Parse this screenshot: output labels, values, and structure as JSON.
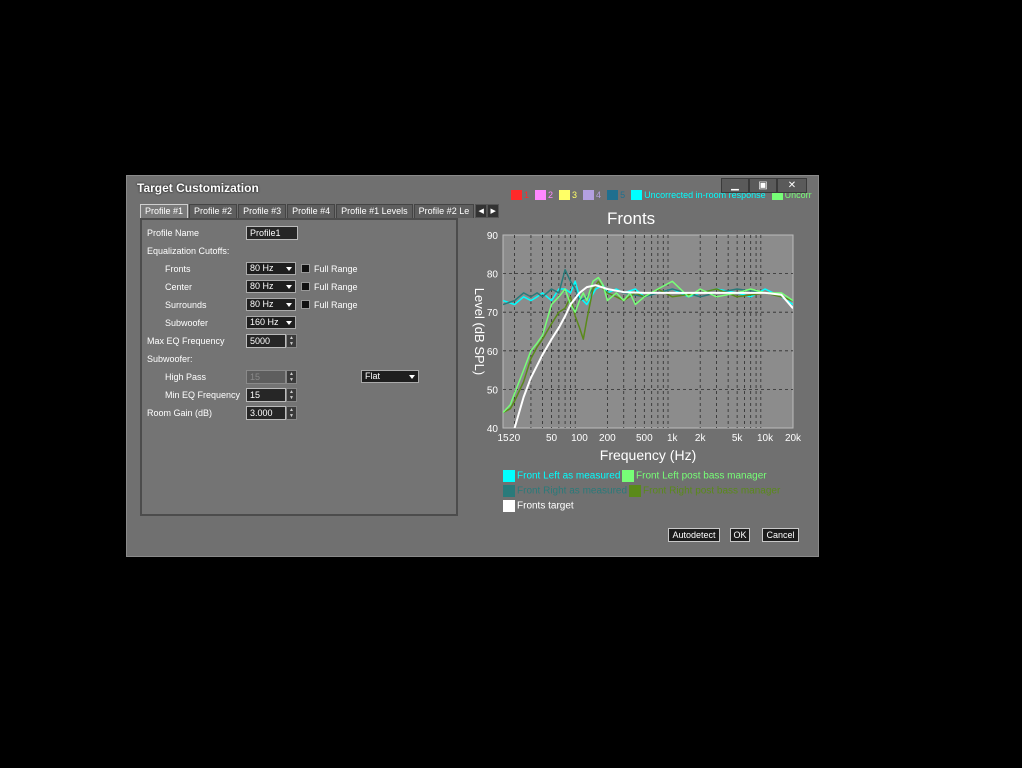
{
  "window": {
    "title": "Target Customization",
    "minimize_glyph": "▁",
    "maximize_glyph": "▣",
    "close_glyph": "✕"
  },
  "channel_swatches": [
    {
      "label": "1",
      "color": "#ff2a2a"
    },
    {
      "label": "2",
      "color": "#ff88ff"
    },
    {
      "label": "3",
      "color": "#ffff66"
    },
    {
      "label": "4",
      "color": "#b3a0e0"
    },
    {
      "label": "5",
      "color": "#1f6f8f"
    },
    {
      "label": "Uncorrected in-room response",
      "color": "#00ffff"
    },
    {
      "label": "Uncorr",
      "color": "#77ff77"
    }
  ],
  "tabs": [
    "Profile #1",
    "Profile #2",
    "Profile #3",
    "Profile #4",
    "Profile #1 Levels",
    "Profile #2 Le"
  ],
  "tab_arrows": {
    "left": "◀",
    "right": "▶"
  },
  "form": {
    "profile_name_label": "Profile Name",
    "profile_name_value": "Profile1",
    "eq_cutoffs_label": "Equalization Cutoffs:",
    "fronts_label": "Fronts",
    "fronts_value": "80 Hz",
    "center_label": "Center",
    "center_value": "80 Hz",
    "surrounds_label": "Surrounds",
    "surrounds_value": "80 Hz",
    "subwoofer_label": "Subwoofer",
    "subwoofer_value": "160 Hz",
    "full_range_label": "Full Range",
    "max_eq_label": "Max EQ Frequency",
    "max_eq_value": "5000",
    "subwoofer_section_label": "Subwoofer:",
    "high_pass_label": "High Pass",
    "high_pass_value": "15",
    "high_pass_mode": "Flat",
    "min_eq_label": "Min EQ Frequency",
    "min_eq_value": "15",
    "room_gain_label": "Room Gain (dB)",
    "room_gain_value": "3.000"
  },
  "buttons": {
    "autodetect": "Autodetect",
    "ok": "OK",
    "cancel": "Cancel"
  },
  "legend": [
    {
      "label": "Front Left as measured",
      "color": "#00ffff"
    },
    {
      "label": "Front Left post bass manager",
      "color": "#77ff77"
    },
    {
      "label": "Front Right as measured",
      "color": "#2a7a7a"
    },
    {
      "label": "Front Right post bass manager",
      "color": "#5a8a1a"
    },
    {
      "label": "Fronts target",
      "color": "#ffffff"
    }
  ],
  "chart_data": {
    "type": "line",
    "title": "Fronts",
    "xlabel": "Frequency (Hz)",
    "ylabel": "Level (dB SPL)",
    "x_scale": "log",
    "xlim": [
      15,
      20000
    ],
    "ylim": [
      40,
      90
    ],
    "x_ticks": [
      15,
      20,
      50,
      100,
      200,
      500,
      1000,
      2000,
      5000,
      10000,
      20000
    ],
    "x_tick_labels": [
      "15",
      "20",
      "50",
      "100",
      "200",
      "500",
      "1k",
      "2k",
      "5k",
      "10k",
      "20k"
    ],
    "y_ticks": [
      40,
      50,
      60,
      70,
      80,
      90
    ],
    "y_tick_labels": [
      "40",
      "50",
      "60",
      "70",
      "80",
      "90"
    ],
    "grid": true,
    "background": "#8c8c8c",
    "series": [
      {
        "name": "Front Left as measured",
        "color": "#00ffff",
        "width": 1.5,
        "x": [
          15,
          20,
          25,
          30,
          35,
          40,
          50,
          60,
          70,
          80,
          90,
          100,
          120,
          150,
          180,
          200,
          250,
          300,
          400,
          500,
          700,
          1000,
          1500,
          2000,
          3000,
          5000,
          7000,
          10000,
          15000,
          20000
        ],
        "y": [
          73,
          72,
          74,
          73,
          74,
          75,
          73,
          76,
          76,
          75,
          78,
          74,
          72,
          76,
          77,
          75,
          76,
          75,
          76,
          74,
          75,
          76,
          74,
          75,
          76,
          75,
          74,
          76,
          74,
          72
        ]
      },
      {
        "name": "Front Right as measured",
        "color": "#2a7a7a",
        "width": 1.5,
        "x": [
          15,
          20,
          25,
          30,
          35,
          40,
          50,
          60,
          70,
          80,
          90,
          100,
          120,
          150,
          200,
          300,
          500,
          700,
          1000,
          2000,
          3000,
          5000,
          10000,
          15000,
          20000
        ],
        "y": [
          72,
          73,
          75,
          74,
          75,
          74,
          76,
          75,
          81,
          78,
          76,
          73,
          74,
          77,
          76,
          75,
          74,
          75,
          76,
          74,
          75,
          76,
          75,
          74,
          73
        ]
      },
      {
        "name": "Front Right post bass manager",
        "color": "#5a8a1a",
        "width": 1.5,
        "x": [
          15,
          18,
          20,
          25,
          30,
          35,
          40,
          50,
          60,
          70,
          80,
          90,
          100,
          110,
          120,
          140,
          160,
          180,
          200,
          250,
          300,
          400,
          500,
          700,
          1000,
          2000,
          3000,
          5000,
          10000,
          15000,
          20000
        ],
        "y": [
          44,
          45,
          47,
          52,
          58,
          61,
          63,
          67,
          70,
          71,
          74,
          69,
          66,
          63,
          68,
          76,
          78,
          76,
          75,
          74,
          73,
          75,
          74,
          76,
          74,
          75,
          76,
          74,
          75,
          74,
          73
        ]
      },
      {
        "name": "Front Left post bass manager",
        "color": "#77ff77",
        "width": 1.5,
        "x": [
          15,
          18,
          20,
          25,
          30,
          35,
          40,
          50,
          60,
          70,
          80,
          90,
          100,
          110,
          120,
          140,
          160,
          180,
          200,
          250,
          300,
          350,
          400,
          500,
          700,
          1000,
          1500,
          2000,
          3000,
          5000,
          7000,
          10000,
          15000,
          20000
        ],
        "y": [
          44,
          46,
          49,
          55,
          60,
          62,
          64,
          72,
          74,
          76,
          72,
          70,
          73,
          75,
          73,
          78,
          79,
          77,
          73,
          75,
          73,
          75,
          72,
          74,
          76,
          78,
          74,
          76,
          74,
          75,
          76,
          75,
          75,
          73
        ]
      },
      {
        "name": "Fronts target",
        "color": "#ffffff",
        "width": 2,
        "x": [
          15,
          20,
          25,
          30,
          40,
          50,
          60,
          70,
          80,
          100,
          120,
          150,
          200,
          300,
          500,
          1000,
          2000,
          5000,
          10000,
          15000,
          20000
        ],
        "y": [
          20,
          40,
          48,
          53,
          59,
          63,
          66,
          69,
          72,
          75,
          76.5,
          77,
          76,
          75.2,
          75,
          75,
          75,
          75,
          75,
          74.5,
          71
        ]
      }
    ]
  }
}
